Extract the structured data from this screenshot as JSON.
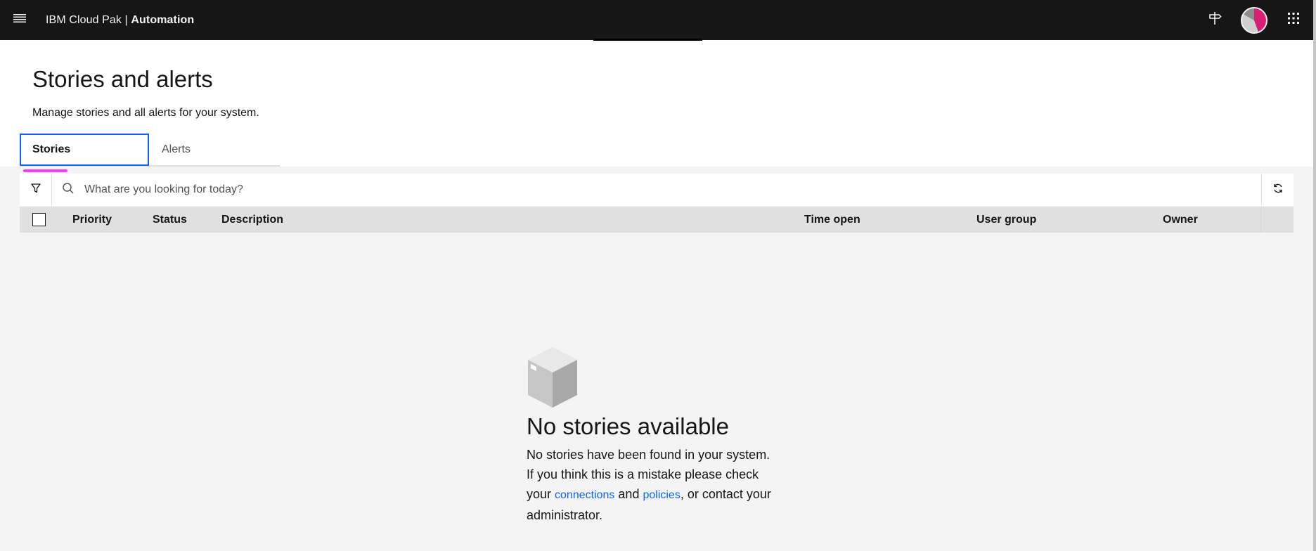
{
  "header": {
    "brand_prefix": "IBM Cloud Pak | ",
    "brand_product": "Automation",
    "icons": {
      "menu": "hamburger-menu-icon",
      "signpost": "signpost-icon",
      "apps": "app-switcher-grid-icon"
    }
  },
  "page": {
    "title": "Stories and alerts",
    "description": "Manage stories and all alerts for your system."
  },
  "tabs": [
    {
      "label": "Stories",
      "active": true
    },
    {
      "label": "Alerts",
      "active": false
    }
  ],
  "toolbar": {
    "search_placeholder": "What are you looking for today?",
    "icons": {
      "filter": "filter-icon",
      "search": "search-icon",
      "refresh": "refresh-icon"
    }
  },
  "table": {
    "columns": [
      "Priority",
      "Status",
      "Description",
      "Time open",
      "User group",
      "Owner"
    ]
  },
  "empty_state": {
    "title": "No stories available",
    "line1": "No stories have been found in your system.",
    "line2": "If you think this is a mistake please check",
    "your": "your ",
    "link_connections": "connections",
    "and": " and ",
    "link_policies": "policies",
    "after": ", or contact your",
    "line4": "administrator."
  },
  "colors": {
    "header_bg": "#161616",
    "accent_blue": "#0f62fe",
    "tab_indicator": "#ff3cf0",
    "avatar_pink": "#da1e74",
    "content_bg": "#f4f4f4",
    "table_head_bg": "#e0e0e0"
  }
}
